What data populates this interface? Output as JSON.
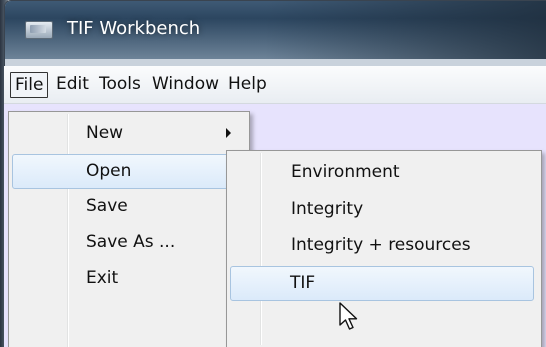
{
  "window": {
    "title": "TIF Workbench",
    "icon": "app-window-icon"
  },
  "menubar": {
    "items": [
      {
        "label": "File",
        "active": true
      },
      {
        "label": "Edit",
        "active": false
      },
      {
        "label": "Tools",
        "active": false
      },
      {
        "label": "Window",
        "active": false
      },
      {
        "label": "Help",
        "active": false
      }
    ]
  },
  "file_menu": {
    "items": [
      {
        "label": "New",
        "submenu": true,
        "highlighted": false
      },
      {
        "label": "Open",
        "submenu": true,
        "highlighted": true
      },
      {
        "label": "Save",
        "submenu": false,
        "highlighted": false
      },
      {
        "label": "Save As ...",
        "submenu": false,
        "highlighted": false
      },
      {
        "label": "Exit",
        "submenu": false,
        "highlighted": false
      }
    ]
  },
  "open_submenu": {
    "items": [
      {
        "label": "Environment",
        "highlighted": false
      },
      {
        "label": "Integrity",
        "highlighted": false
      },
      {
        "label": "Integrity + resources",
        "highlighted": false
      },
      {
        "label": "TIF",
        "highlighted": true
      }
    ]
  },
  "colors": {
    "client_background": "#e7e3fd",
    "menu_background": "#f0f0f0",
    "highlight_border": "#a8c4e0",
    "titlebar": "#2c4660"
  },
  "cursor": "arrow-cursor-icon"
}
